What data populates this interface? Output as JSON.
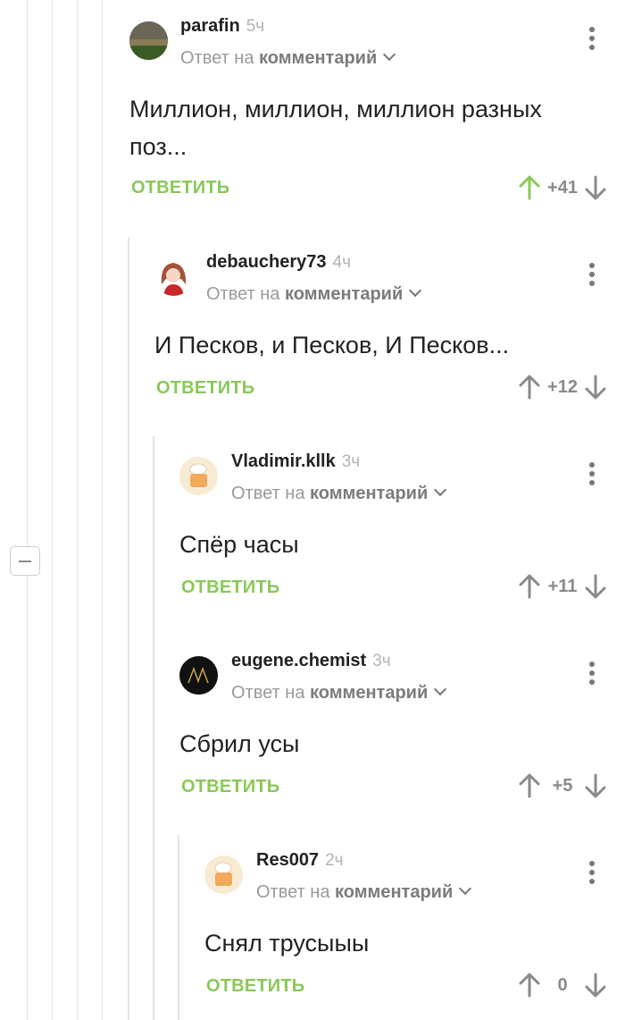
{
  "ui": {
    "reply_label": "ОТВЕТИТЬ",
    "reply_to_prefix": "Ответ на",
    "reply_to_target": "комментарий"
  },
  "comments": [
    {
      "author": "parafin",
      "time": "5ч",
      "text": "Миллион, миллион, миллион разных поз...",
      "rating": "+41",
      "upvoted": true
    },
    {
      "author": "debauchery73",
      "time": "4ч",
      "text": "И Песков, и Песков, И Песков...",
      "rating": "+12",
      "upvoted": false
    },
    {
      "author": "Vladimir.kllk",
      "time": "3ч",
      "text": "Спёр часы",
      "rating": "+11",
      "upvoted": false
    },
    {
      "author": "eugene.chemist",
      "time": "3ч",
      "text": "Сбрил усы",
      "rating": "+5",
      "upvoted": false
    },
    {
      "author": "Res007",
      "time": "2ч",
      "text": "Снял трусыыы",
      "rating": "0",
      "upvoted": false
    }
  ],
  "colors": {
    "accent_green": "#8ac858",
    "muted": "#9a9a9a"
  }
}
